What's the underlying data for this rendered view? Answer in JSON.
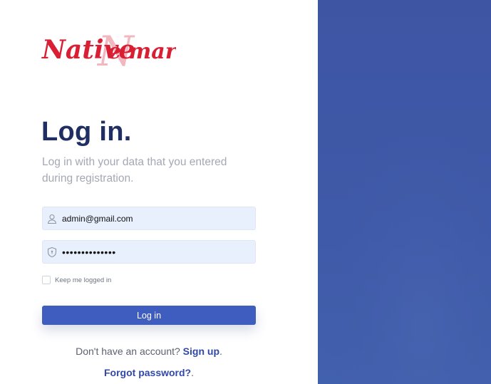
{
  "brand": {
    "logo_text": "Native e mart",
    "logo_primary_color": "#d81f33",
    "logo_accent_color": "#f2b8c0"
  },
  "login": {
    "title": "Log in.",
    "subtitle": "Log in with your data that you entered during registration.",
    "email_value": "admin@gmail.com",
    "password_value": "••••••••••••••",
    "remember_label": "Keep me logged in",
    "remember_checked": false,
    "submit_label": "Log in"
  },
  "footer": {
    "signup_prompt": "Don't have an account?",
    "signup_link": "Sign up",
    "signup_suffix": ".",
    "forgot_link": "Forgot password?",
    "forgot_suffix": "."
  },
  "colors": {
    "heading": "#1f2f63",
    "button": "#3f5cbf",
    "link": "#3148a8",
    "right_panel": "#3f5aa8",
    "input_bg": "#e8f0fe"
  },
  "icons": {
    "email_field": "user-icon",
    "password_field": "shield-icon"
  }
}
